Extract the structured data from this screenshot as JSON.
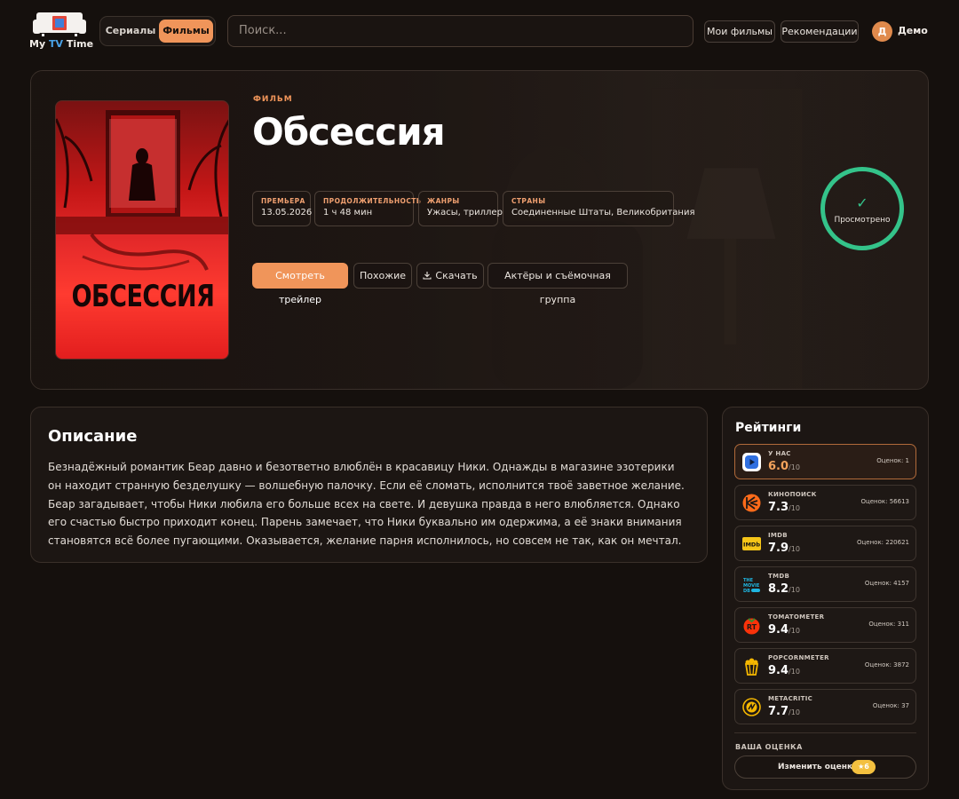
{
  "header": {
    "logo": {
      "text_before": "My",
      "text_tv": "TV",
      "text_after": "Time"
    },
    "mode": {
      "series_label": "Сериалы",
      "films_label": "Фильмы",
      "active": "films"
    },
    "search": {
      "placeholder": "Поиск..."
    },
    "nav": {
      "my_films": "Мои фильмы",
      "recommendations": "Рекомендации"
    },
    "user": {
      "initial": "Д",
      "name": "Демо"
    }
  },
  "movie": {
    "kind": "ФИЛЬМ",
    "title": "Обсессия",
    "poster_title": "ОБСЕССИЯ",
    "info": [
      {
        "label": "ПРЕМЬЕРА",
        "value": "13.05.2026"
      },
      {
        "label": "ПРОДОЛЖИТЕЛЬНОСТЬ",
        "value": "1 ч 48 мин"
      },
      {
        "label": "ЖАНРЫ",
        "value": "Ужасы, триллер"
      },
      {
        "label": "СТРАНЫ",
        "value": "Соединенные Штаты, Великобритания"
      }
    ],
    "actions": {
      "trailer": "Смотреть трейлер",
      "similar": "Похожие",
      "download": "Скачать",
      "cast": "Актёры и съёмочная группа"
    },
    "watched": {
      "check": "✓",
      "label": "Просмотрено"
    }
  },
  "description": {
    "title": "Описание",
    "text": "Безнадёжный романтик Беар давно и безответно влюблён в красавицу Ники. Однажды в магазине эзотерики он находит странную безделушку — волшебную палочку. Если её сломать, исполнится твоё заветное желание. Беар загадывает, чтобы Ники любила его больше всех на свете. И девушка правда в него влюбляется. Однако его счастью быстро приходит конец. Парень замечает, что Ники буквально им одержима, а её знаки внимания становятся всё более пугающими. Оказывается, желание парня исполнилось, но совсем не так, как он мечтал."
  },
  "ratings": {
    "title": "Рейтинги",
    "max": "/10",
    "items": [
      {
        "source": "У НАС",
        "value": "6.0",
        "count": "Оценок: 1",
        "icon": "play-icon",
        "color": "#2f6fe0"
      },
      {
        "source": "КИНОПОИСК",
        "value": "7.3",
        "count": "Оценок: 56613",
        "icon": "kinopoisk-icon",
        "color": "#ff6b1a"
      },
      {
        "source": "IMDB",
        "value": "7.9",
        "count": "Оценок: 220621",
        "icon": "imdb-icon",
        "color": "#f5c518"
      },
      {
        "source": "TMDB",
        "value": "8.2",
        "count": "Оценок: 4157",
        "icon": "tmdb-icon",
        "color": "#1fb5e0"
      },
      {
        "source": "TOMATOMETER",
        "value": "9.4",
        "count": "Оценок: 311",
        "icon": "tomato-icon",
        "color": "#fa320a"
      },
      {
        "source": "POPCORNMETER",
        "value": "9.4",
        "count": "Оценок: 3872",
        "icon": "popcorn-icon",
        "color": "#f5b700"
      },
      {
        "source": "METACRITIC",
        "value": "7.7",
        "count": "Оценок: 37",
        "icon": "metacritic-icon",
        "color": "#f5b700"
      }
    ],
    "your_rating_label": "ВАША ОЦЕНКА",
    "change_button": "Изменить оценку",
    "your_rating": "6",
    "star": "★"
  },
  "colors": {
    "accent": "#f0955a",
    "watched": "#34c38a",
    "background": "#15100d"
  }
}
